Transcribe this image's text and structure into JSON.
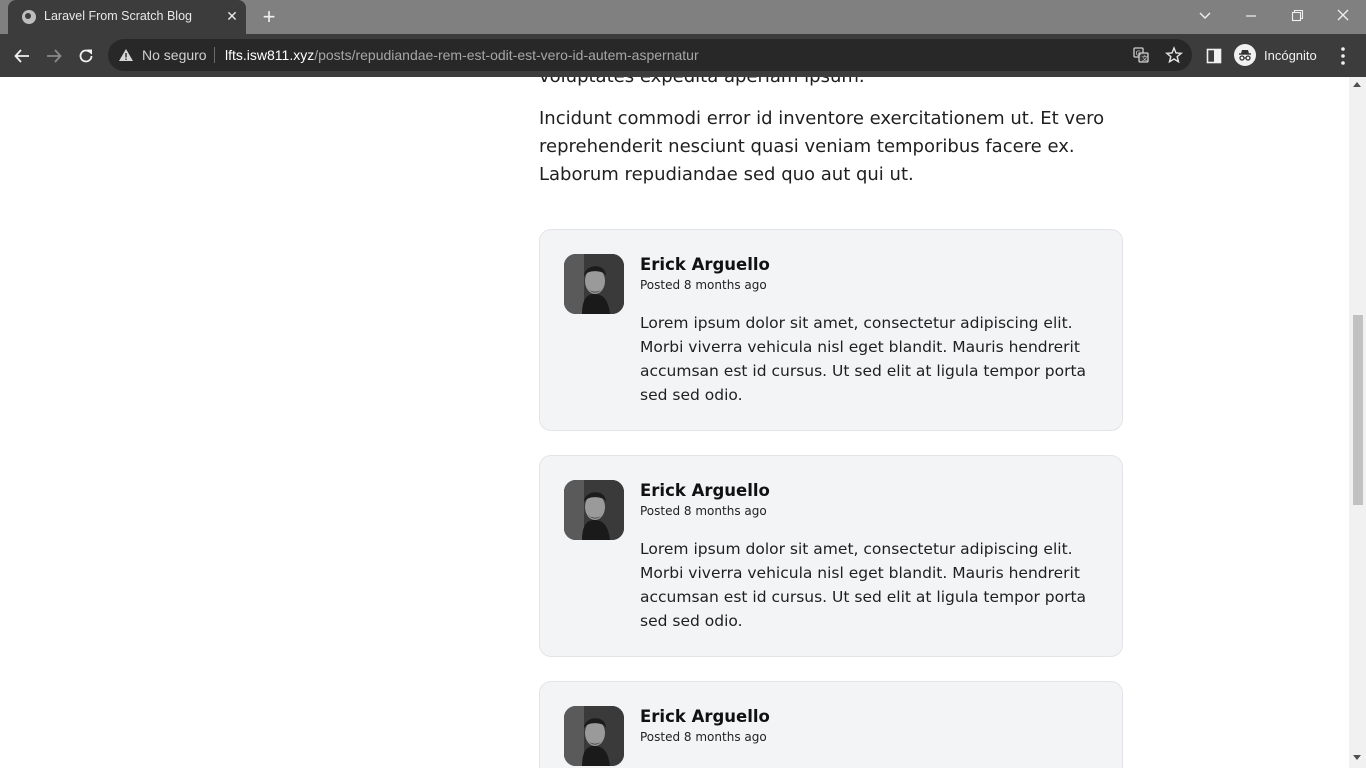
{
  "browser": {
    "tab_title": "Laravel From Scratch Blog",
    "security_label": "No seguro",
    "url_host": "lfts.isw811.xyz",
    "url_path": "/posts/repudiandae-rem-est-odit-est-vero-id-autem-aspernatur",
    "profile_label": "Incógnito",
    "icons": [
      "globe-icon",
      "close-icon",
      "plus-icon",
      "chevron-down-icon",
      "minimize-icon",
      "restore-icon",
      "back-icon",
      "forward-icon",
      "reload-icon",
      "warning-icon",
      "translate-icon",
      "star-icon",
      "side-panel-icon",
      "incognito-icon",
      "more-vert-icon"
    ]
  },
  "article": {
    "cut_paragraph": "voluptates expedita aperiam ipsum.",
    "paragraph": "Incidunt commodi error id inventore exercitationem ut. Et vero reprehenderit nesciunt quasi veniam temporibus facere ex. Laborum repudiandae sed quo aut qui ut."
  },
  "comments": [
    {
      "author": "Erick Arguello",
      "posted": "Posted 8 months ago",
      "body": "Lorem ipsum dolor sit amet, consectetur adipiscing elit. Morbi viverra vehicula nisl eget blandit. Mauris hendrerit accumsan est id cursus. Ut sed elit at ligula tempor porta sed sed odio."
    },
    {
      "author": "Erick Arguello",
      "posted": "Posted 8 months ago",
      "body": "Lorem ipsum dolor sit amet, consectetur adipiscing elit. Morbi viverra vehicula nisl eget blandit. Mauris hendrerit accumsan est id cursus. Ut sed elit at ligula tempor porta sed sed odio."
    },
    {
      "author": "Erick Arguello",
      "posted": "Posted 8 months ago"
    }
  ]
}
